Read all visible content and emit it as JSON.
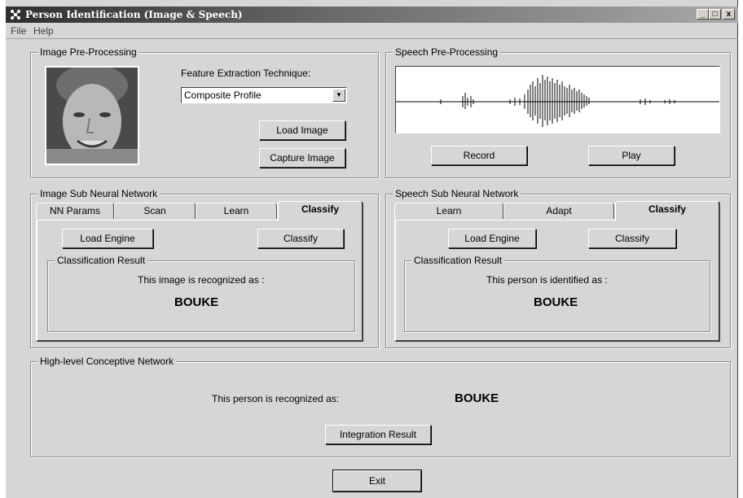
{
  "window": {
    "title": "Person Identification (Image & Speech)",
    "controls": {
      "minimize": "_",
      "maximize": "□",
      "close": "x"
    }
  },
  "menu": [
    "File",
    "Help"
  ],
  "image_preprocessing": {
    "label": "Image Pre-Processing",
    "feature_label": "Feature Extraction Technique:",
    "feature_value": "Composite Profile",
    "load_image": "Load Image",
    "capture_image": "Capture Image"
  },
  "speech_preprocessing": {
    "label": "Speech Pre-Processing",
    "record": "Record",
    "play": "Play"
  },
  "image_snn": {
    "label": "Image Sub Neural Network",
    "tabs": [
      "NN Params",
      "Scan",
      "Learn",
      "Classify"
    ],
    "active_tab": "Classify",
    "load_engine": "Load Engine",
    "classify": "Classify",
    "result_label": "Classification Result",
    "result_text": "This image is recognized as :",
    "result_value": "BOUKE"
  },
  "speech_snn": {
    "label": "Speech  Sub Neural Network",
    "tabs": [
      "Learn",
      "Adapt",
      "Classify"
    ],
    "active_tab": "Classify",
    "load_engine": "Load Engine",
    "classify": "Classify",
    "result_label": "Classification Result",
    "result_text": "This person is identified as :",
    "result_value": "BOUKE"
  },
  "highlevel": {
    "label": "High-level Conceptive Network",
    "result_text": "This person is recognized as:",
    "result_value": "BOUKE",
    "integration": "Integration Result"
  },
  "exit": "Exit"
}
